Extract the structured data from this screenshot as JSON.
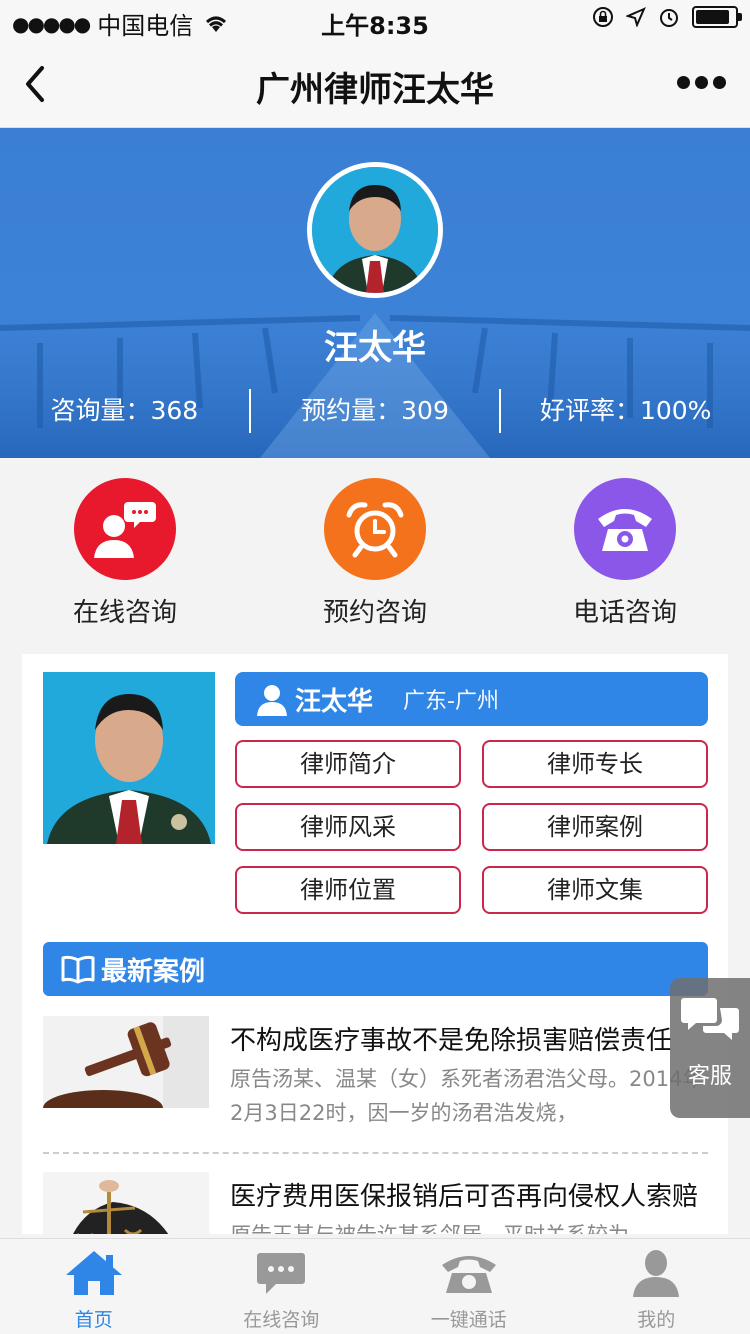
{
  "status_bar": {
    "carrier": "中国电信",
    "time": "上午8:35"
  },
  "nav": {
    "title": "广州律师汪太华"
  },
  "hero": {
    "name": "汪太华",
    "stats": [
      {
        "label": "咨询量：368"
      },
      {
        "label": "预约量：309"
      },
      {
        "label": "好评率：100%"
      }
    ]
  },
  "actions": [
    {
      "label": "在线咨询",
      "color": "#e8192c",
      "icon": "chat-person-icon"
    },
    {
      "label": "预约咨询",
      "color": "#f4721b",
      "icon": "alarm-clock-icon"
    },
    {
      "label": "电话咨询",
      "color": "#8b57e8",
      "icon": "telephone-icon"
    }
  ],
  "profile": {
    "name": "汪太华",
    "location": "广东-广州",
    "buttons": [
      "律师简介",
      "律师专长",
      "律师风采",
      "律师案例",
      "律师位置",
      "律师文集"
    ]
  },
  "latest_cases": {
    "heading": "最新案例",
    "items": [
      {
        "title": "不构成医疗事故不是免除损害赔偿责任",
        "desc": "原告汤某、温某（女）系死者汤君浩父母。2014年2月3日22时，因一岁的汤君浩发烧，"
      },
      {
        "title": "医疗费用医保报销后可否再向侵权人索赔",
        "desc": "原告王某与被告许某系邻居，平时关系较为"
      }
    ]
  },
  "service": {
    "label": "客服"
  },
  "tabbar": [
    {
      "label": "首页",
      "active": true
    },
    {
      "label": "在线咨询",
      "active": false
    },
    {
      "label": "一键通话",
      "active": false
    },
    {
      "label": "我的",
      "active": false
    }
  ],
  "colors": {
    "primary": "#2f86e6",
    "button_border": "#c8294a"
  }
}
